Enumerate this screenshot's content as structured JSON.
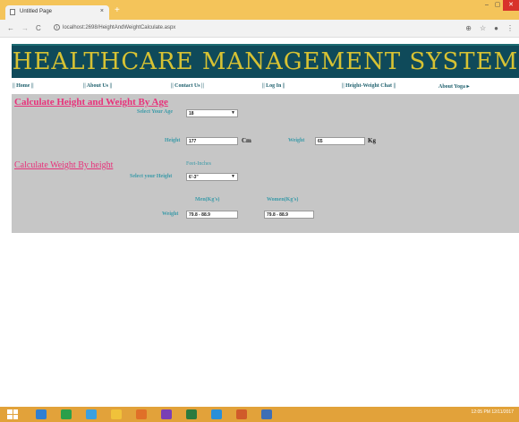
{
  "browser": {
    "tab_title": "Untitled Page",
    "tab_close": "×",
    "new_tab": "+",
    "url": "localhost:2698/HeightAndWeightCalculate.aspx",
    "minimize": "–",
    "maximize": "▢",
    "close": "✕"
  },
  "banner": {
    "title": "HEALTHCARE MANAGEMENT SYSTEM"
  },
  "menu": {
    "home": "|| Home ||",
    "about_us": "|| About Us ||",
    "contact_us": "|| Contact Us ||",
    "log_in": "|| Log In ||",
    "height_weight_chat": "|| Height-Weight Chat ||",
    "about_yoga": "About Yoga ▸"
  },
  "section1": {
    "heading": "Calculate Height and Weight By Age",
    "age_label": "Select Your Age",
    "age_value": "18",
    "height_label": "Height",
    "height_value": "177",
    "height_unit": "Cm",
    "weight_label": "Weight",
    "weight_value": "65",
    "weight_unit": "Kg"
  },
  "section2": {
    "heading": "Calculate Weight By height",
    "feet_inches_label": "Feet-Inches",
    "height_label": "Select your Height",
    "height_value": "6'-3\"",
    "men_label": "Men(Kg's)",
    "women_label": "Women(Kg's)",
    "weight_label": "Weight",
    "men_value": "79.8 - 88.9",
    "women_value": "79.8 - 88.9"
  },
  "taskbar": {
    "time": "12:05 PM",
    "date": "12/11/2017"
  }
}
